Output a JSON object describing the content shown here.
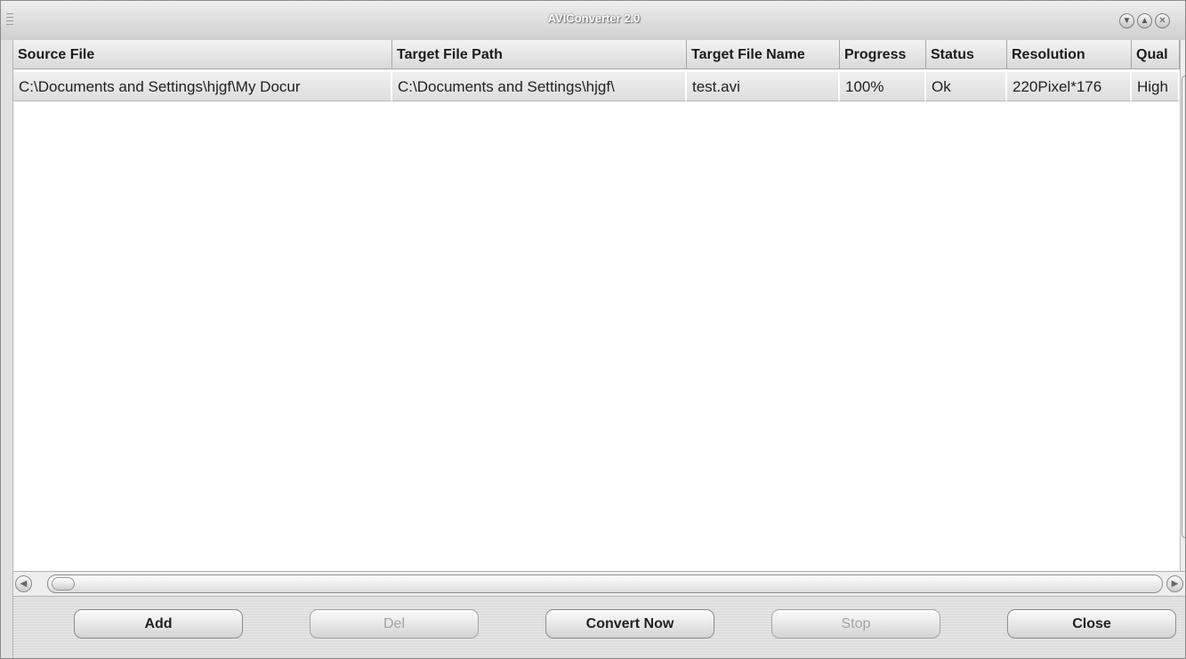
{
  "window": {
    "title": "AVIConverter 2.0"
  },
  "table": {
    "columns": [
      "Source File",
      "Target File Path",
      "Target File Name",
      "Progress",
      "Status",
      "Resolution",
      "Qual"
    ],
    "rows": [
      [
        "C:\\Documents and Settings\\hjgf\\My Docur",
        "C:\\Documents and Settings\\hjgf\\",
        "test.avi",
        "100%",
        "Ok",
        "220Pixel*176",
        "High"
      ]
    ]
  },
  "buttons": {
    "add": "Add",
    "del": "Del",
    "convert": "Convert Now",
    "stop": "Stop",
    "close": "Close"
  },
  "icons": {
    "minimize": "chevron-down-icon",
    "maximize": "chevron-up-icon",
    "close": "close-icon",
    "scroll_left": "arrow-left-icon",
    "scroll_right": "arrow-right-icon"
  }
}
